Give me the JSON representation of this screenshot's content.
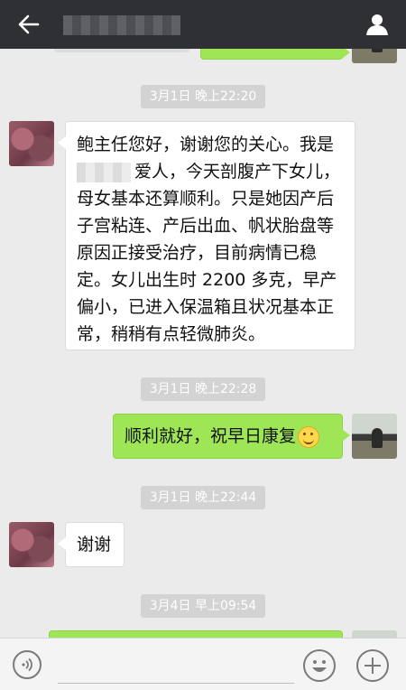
{
  "messages": {
    "ts1": "3月1日 晚上22:20",
    "m1": [
      "鲍主任您好，谢谢您的关心。我是",
      "爱人，今天剖腹产下女儿，",
      "母女基本还算顺利。只是她因产后",
      "子宫粘连、产后出血、帆状胎盘等",
      "原因正接受治疗，目前病情已稳",
      "定。女儿出生时 2200 多克，早产",
      "偏小，已进入保温箱且状况基本正",
      "常，稍稍有点轻微肺炎。"
    ],
    "ts2": "3月1日 晚上22:28",
    "m2": "顺利就好，祝早日康复",
    "ts3": "3月1日 晚上22:44",
    "m3": "谢谢",
    "ts4": "3月4日 早上09:54"
  },
  "icons": {
    "back": "back-arrow-icon",
    "profile": "person-icon",
    "voice": "voice-icon",
    "emoji": "emoji-icon",
    "plus": "plus-icon",
    "smile": "smile-emoji-icon"
  },
  "colors": {
    "topbar": "#2f3034",
    "background": "#ebebeb",
    "bubble_right": "#9fe657",
    "bubble_left": "#ffffff"
  }
}
